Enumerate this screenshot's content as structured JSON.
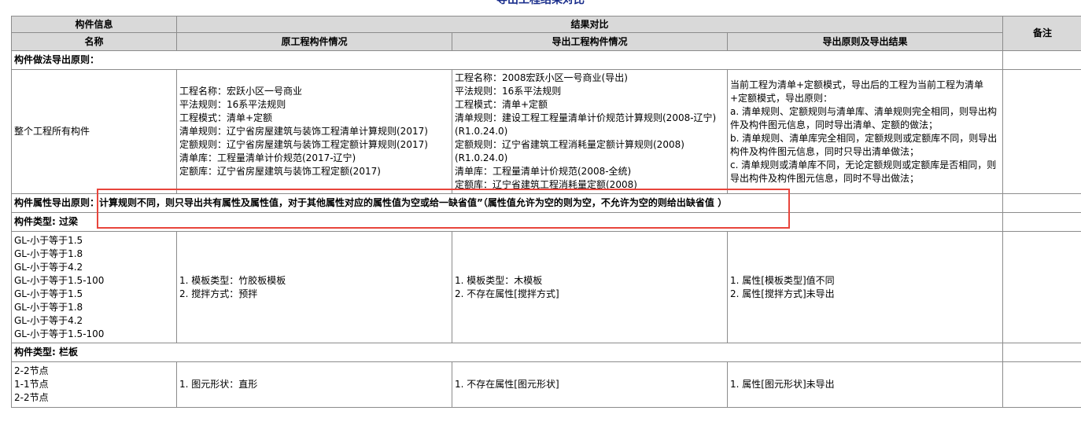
{
  "title": "导出工程结果对比",
  "header": {
    "component_info": "构件信息",
    "result_compare": "结果对比",
    "remark": "备注",
    "name": "名称",
    "original": "原工程构件情况",
    "exported": "导出工程构件情况",
    "principle": "导出原则及导出结果"
  },
  "section1": {
    "title": "构件做法导出原则：",
    "name": "整个工程所有构件",
    "original_lines": [
      "工程名称：宏跃小区一号商业",
      "平法规则：16系平法规则",
      "工程模式：清单+定额",
      "清单规则：辽宁省房屋建筑与装饰工程清单计算规则(2017)",
      "定额规则：辽宁省房屋建筑与装饰工程定额计算规则(2017)",
      "清单库：工程量清单计价规范(2017-辽宁)",
      "定额库：辽宁省房屋建筑与装饰工程定额(2017)"
    ],
    "exported_lines": [
      "工程名称：2008宏跃小区一号商业(导出)",
      "平法规则：16系平法规则",
      "工程模式：清单+定额",
      "清单规则：建设工程工程量清单计价规范计算规则(2008-辽宁)(R1.0.24.0)",
      "定额规则：辽宁省建筑工程消耗量定额计算规则(2008)(R1.0.24.0)",
      "清单库：工程量清单计价规范(2008-全统)",
      "定额库：辽宁省建筑工程消耗量定额(2008)"
    ],
    "principle_lines": [
      "当前工程为清单+定额模式，导出后的工程为当前工程为清单+定额模式，导出原则：",
      "a. 清单规则、定额规则与清单库、清单规则完全相同，则导出构件及构件图元信息，同时导出清单、定额的做法；",
      "b. 清单规则、清单库完全相同，定额规则或定额库不同，则导出构件及构件图元信息，同时只导出清单做法；",
      "c. 清单规则或清单库不同，无论定额规则或定额库是否相同，则导出构件及构件图元信息，同时不导出做法；"
    ]
  },
  "attr_principle": "构件属性导出原则：计算规则不同，则只导出共有属性及属性值，对于其他属性对应的属性值为空或给一缺省值”（属性值允许为空的则为空，不允许为空的则给出缺省值 ）",
  "section2": {
    "title": "构件类型: 过梁",
    "names": [
      "GL-小于等于1.5",
      "GL-小于等于1.8",
      "GL-小于等于4.2",
      "GL-小于等于1.5-100",
      "GL-小于等于1.5",
      "GL-小于等于1.8",
      "GL-小于等于4.2",
      "GL-小于等于1.5-100"
    ],
    "original_lines": [
      "1. 模板类型：竹胶板模板",
      "2. 搅拌方式：预拌"
    ],
    "exported_lines": [
      "1. 模板类型：木模板",
      "2. 不存在属性[搅拌方式]"
    ],
    "principle_lines": [
      "1. 属性[模板类型]值不同",
      "2. 属性[搅拌方式]未导出"
    ]
  },
  "section3": {
    "title": "构件类型: 栏板",
    "names": [
      "2-2节点",
      "1-1节点",
      "2-2节点"
    ],
    "original_lines": [
      "1. 图元形状：直形"
    ],
    "exported_lines": [
      "1. 不存在属性[图元形状]"
    ],
    "principle_lines": [
      "1. 属性[图元形状]未导出"
    ]
  },
  "colors": {
    "header_bg": "#d9d9d9",
    "border": "#8c8c8c",
    "highlight": "#e8453c",
    "title": "#1a2e8c"
  }
}
